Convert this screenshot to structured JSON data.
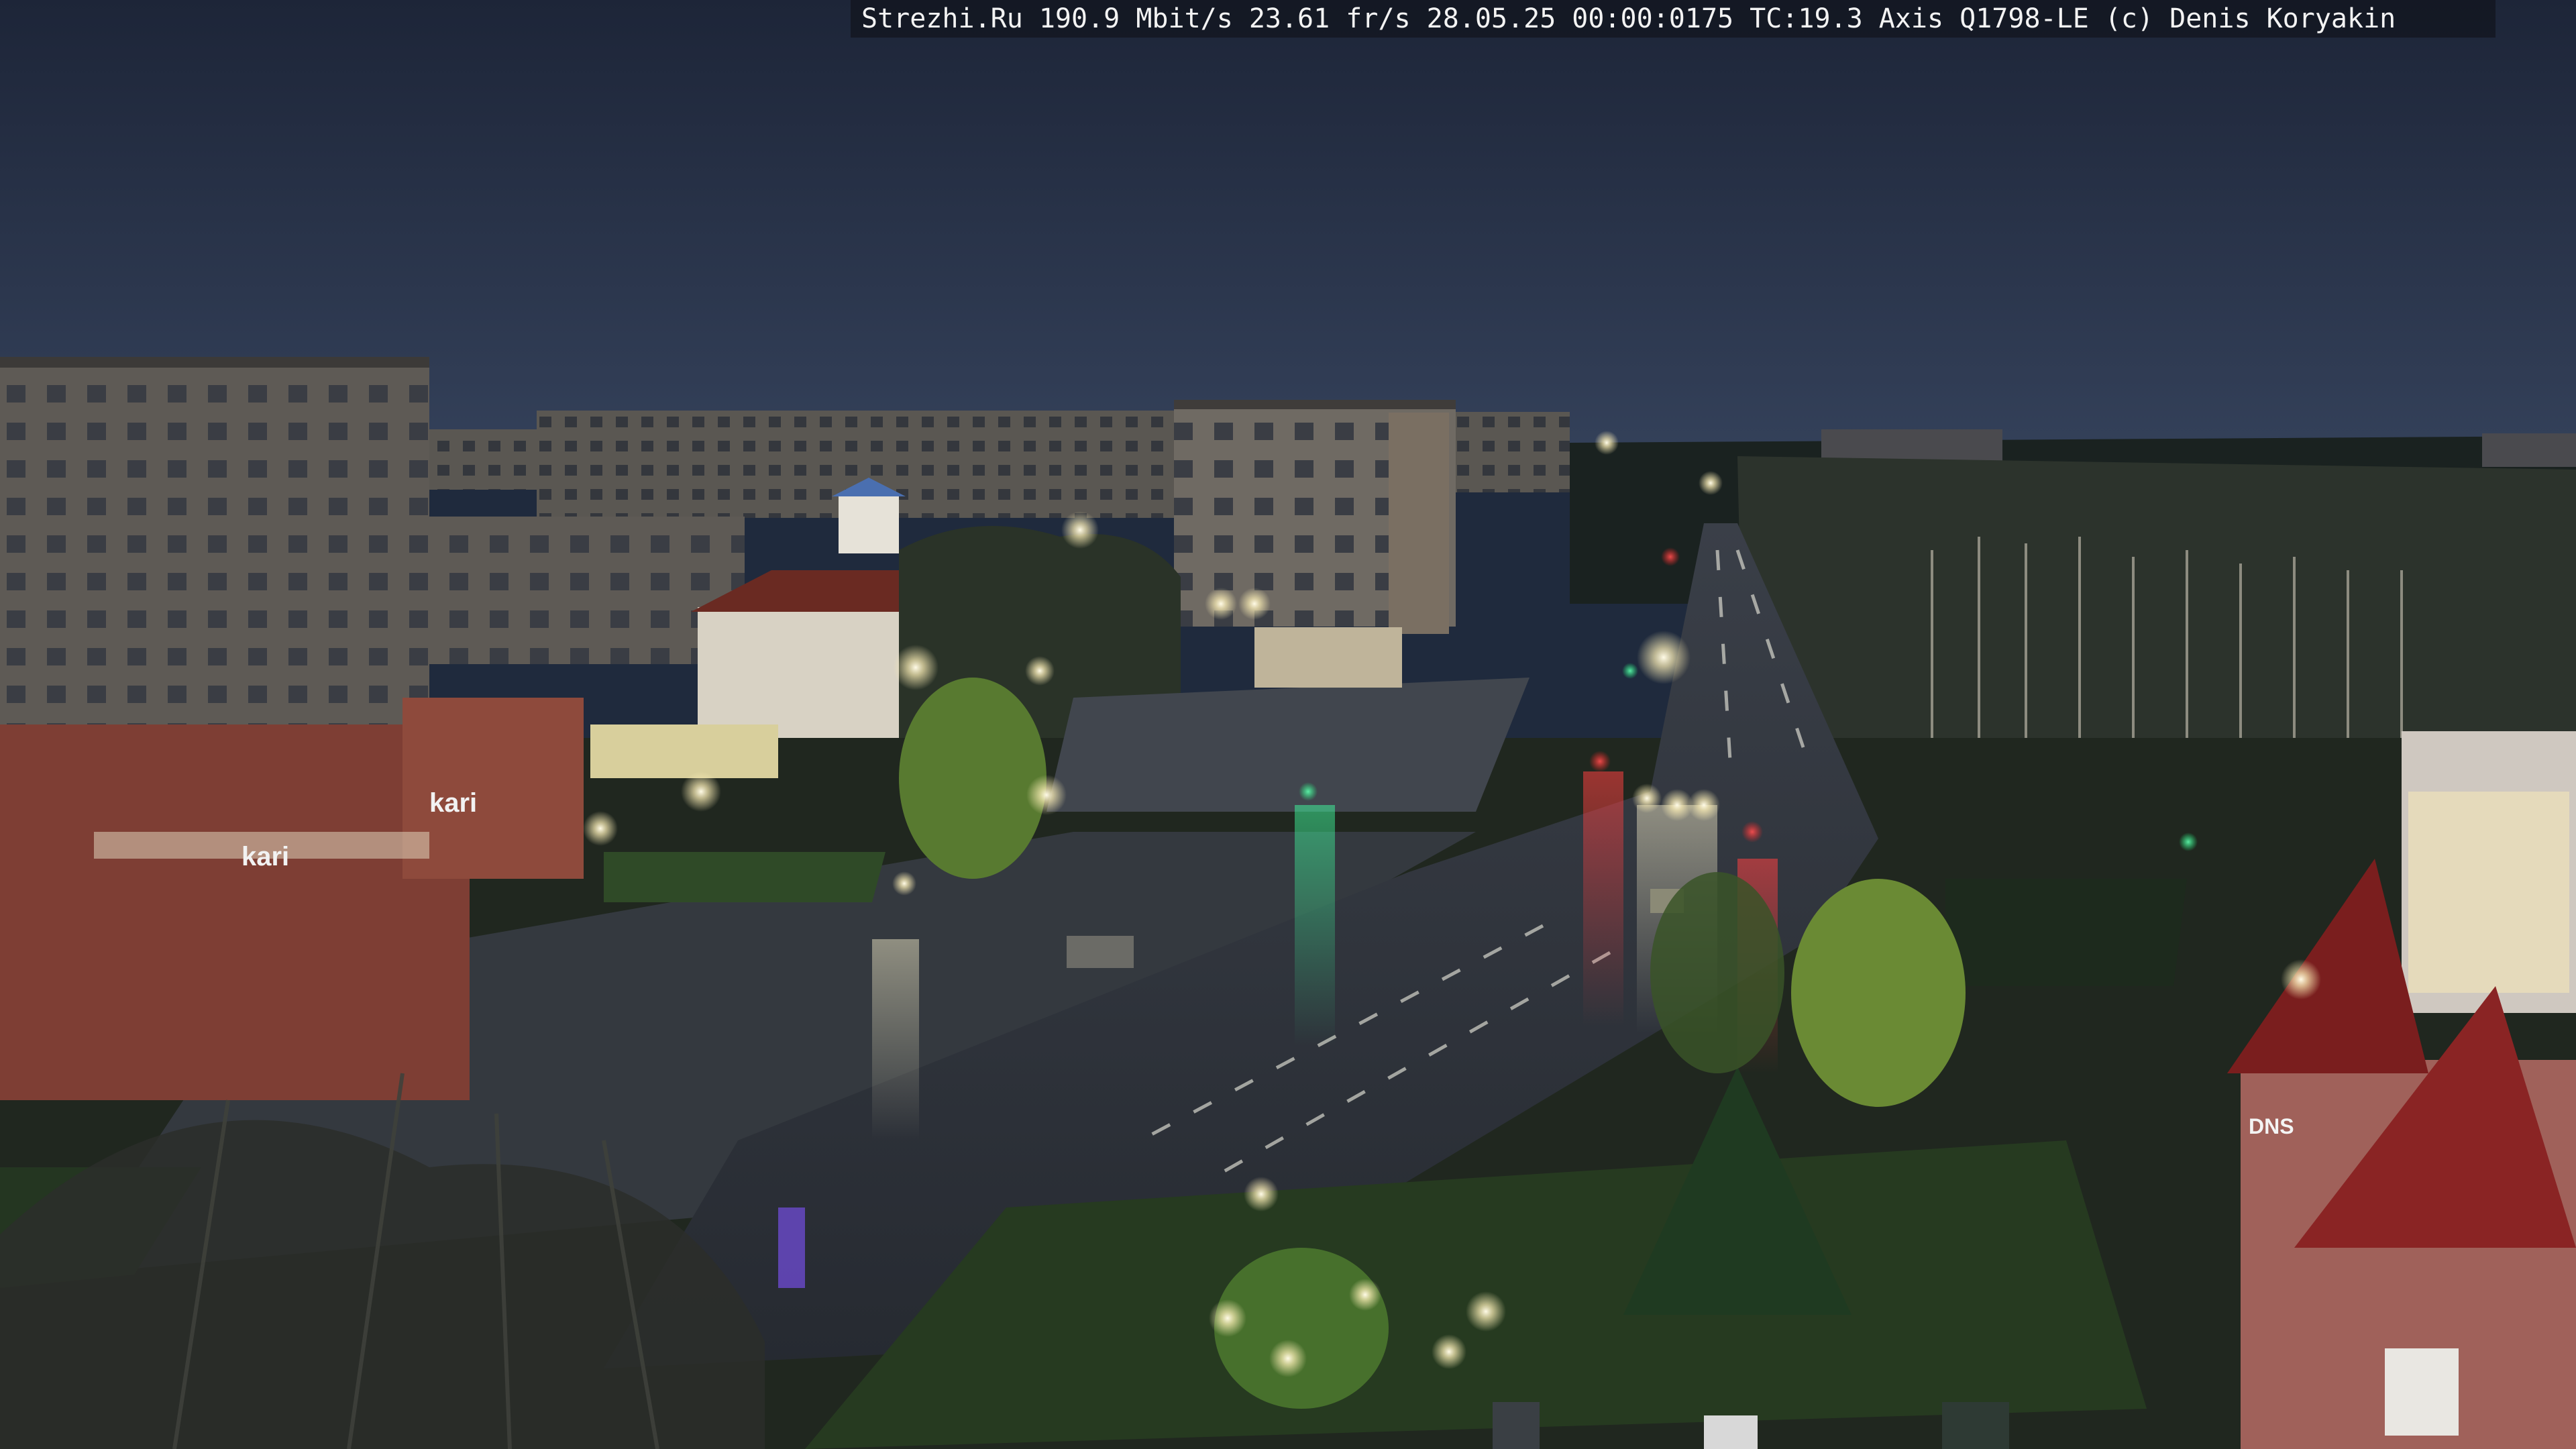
{
  "camera_overlay": {
    "site": "Strezhi.Ru",
    "bitrate": "190.9 Mbit/s",
    "framerate": "23.61 fr/s",
    "date": "28.05.25",
    "time": "00:00:0175",
    "tc": "TC:19.3",
    "camera_model": "Axis Q1798-LE",
    "copyright": "(c) Denis Koryakin"
  },
  "signage": {
    "store_sign_1": "kari",
    "store_sign_2": "kari",
    "store_sign_3": "DNS"
  },
  "colors": {
    "sky": "#26324a",
    "ground": "#1c241c",
    "road": "#2c3038",
    "lamp_glow": "#fff6d8",
    "traffic_red": "#ff3030",
    "traffic_green": "#30ff90"
  }
}
